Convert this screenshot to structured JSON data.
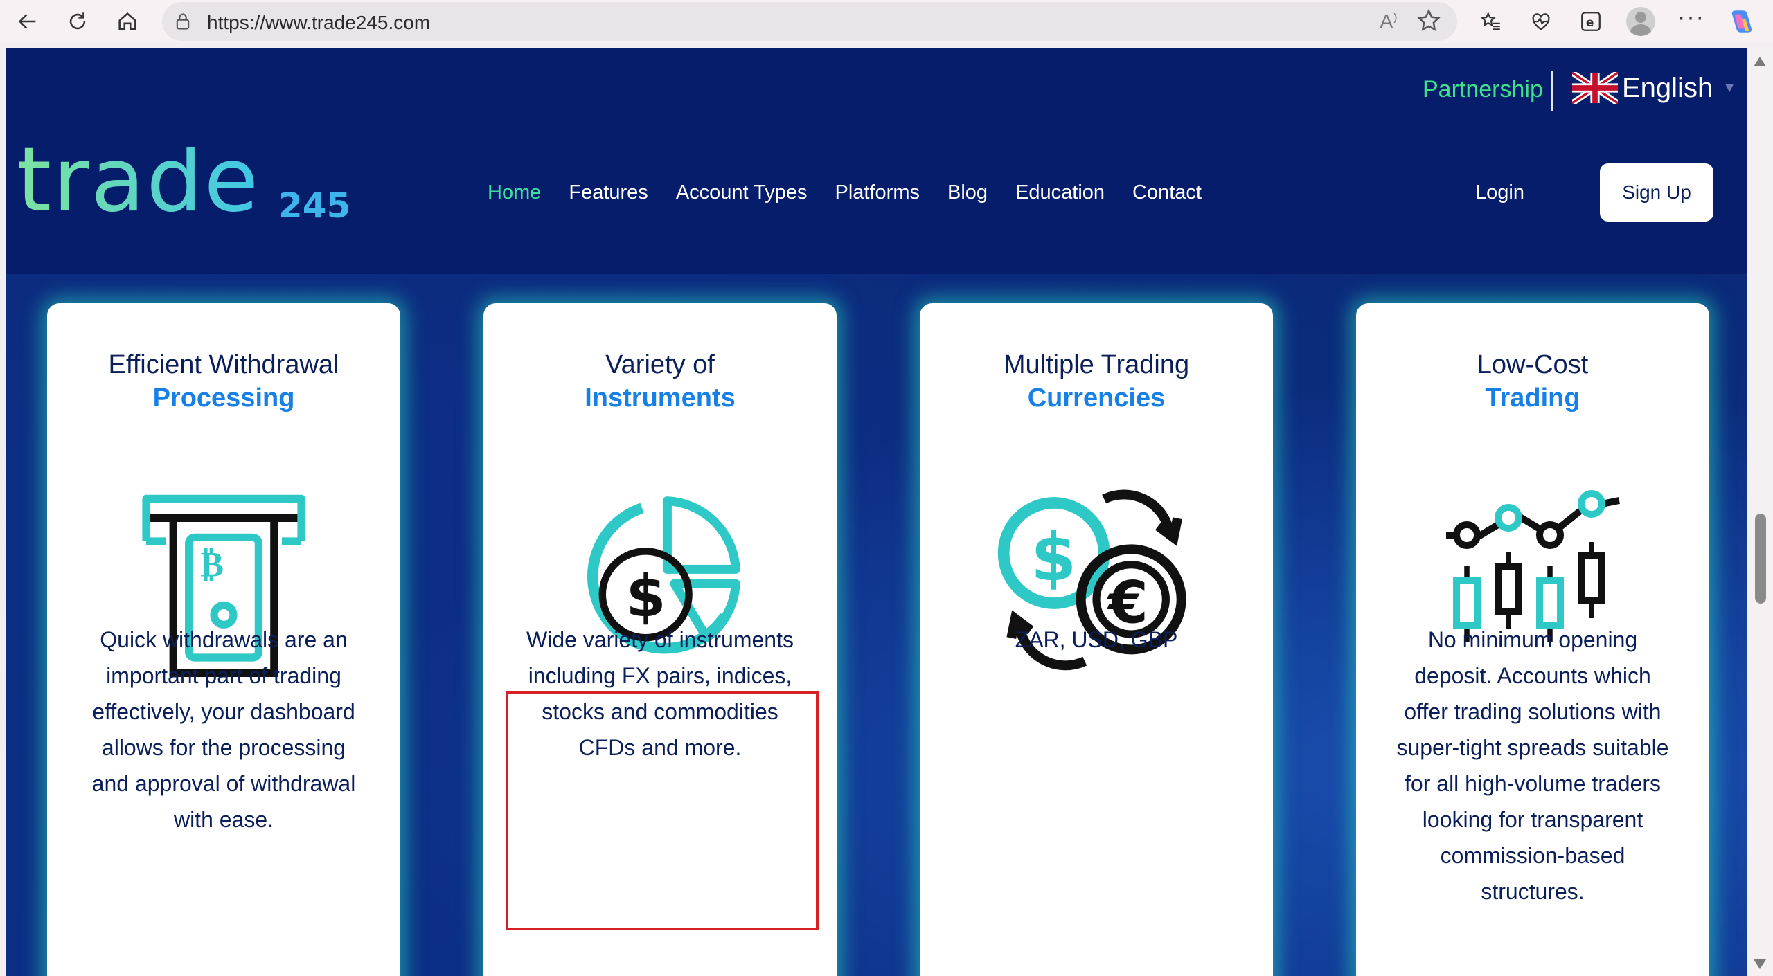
{
  "browser": {
    "url": "https://www.trade245.com",
    "read_aloud": "A⁾"
  },
  "header": {
    "partnership": "Partnership",
    "language": "English",
    "logo_text": "trade",
    "logo_suffix": "245",
    "nav": [
      "Home",
      "Features",
      "Account Types",
      "Platforms",
      "Blog",
      "Education",
      "Contact"
    ],
    "login": "Login",
    "signup": "Sign Up"
  },
  "colors": {
    "page_bg": "#061d6b",
    "accent_green": "#3ee08a",
    "accent_blue": "#1780e6",
    "teal_icon": "#2ec9c6",
    "highlight_red": "#d81f26"
  },
  "cards": [
    {
      "title_line1": "Efficient Withdrawal",
      "title_line2": "Processing",
      "icon": "atm-withdrawal-icon",
      "description": "Quick withdrawals are an important part of trading effectively, your dashboard allows for the processing and approval of withdrawal with ease."
    },
    {
      "title_line1": "Variety of",
      "title_line2": "Instruments",
      "icon": "dollar-pie-chart-icon",
      "description": "Wide variety of instruments including FX pairs, indices, stocks and commodities CFDs and more."
    },
    {
      "title_line1": "Multiple Trading",
      "title_line2": "Currencies",
      "icon": "currency-exchange-icon",
      "description": "ZAR, USD, GBP"
    },
    {
      "title_line1": "Low-Cost",
      "title_line2": "Trading",
      "icon": "candlestick-chart-icon",
      "description": "No minimum opening deposit. Accounts which offer trading solutions with super-tight spreads suitable for all high-volume traders looking for transparent commission-based structures."
    }
  ]
}
